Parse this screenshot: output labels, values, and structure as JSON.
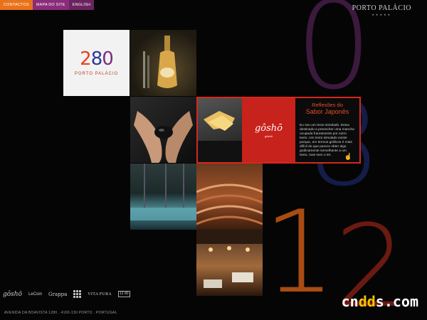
{
  "nav": {
    "contactos": "CONTACTOS",
    "mapa": "MAPA DO SITE",
    "english": "ENGLISH"
  },
  "brand": {
    "name": "PORTO PALÁCIO",
    "stars": "★★★★★"
  },
  "decor": {
    "top_digit": "0",
    "mid_digit": "8",
    "bottom_one": "1",
    "bottom_digit": "2"
  },
  "logo": {
    "num_1": "2",
    "num_8": "8",
    "num_0": "0",
    "sub": "PORTO PALÁCIO"
  },
  "feature": {
    "heading_top": "Reflexões do",
    "heading_bottom": "Sabor Japonês",
    "logo_text": "gôshō",
    "logo_sub": "gôshō",
    "body": "Eu sou um texto simulado. Estou destinado a preencher uma mancha ocupada futuramente por outro texto. Um texto simulado existe porque, em termos gráficos é mais difícil do que parece obter algo graficamente semelhante a um texto, mas sem o ter."
  },
  "partners": {
    "gosho": "gôshō",
    "lecoin": "LeCoin",
    "grappa": "Grappa",
    "vitapura": "VITA PURA",
    "last": "12 80"
  },
  "address": "AVENIDA DA BOAVISTA 1280 . 4100-130 PORTO . PORTUGAL",
  "watermark": {
    "a": "cn",
    "b": "dd",
    "c": "s.com"
  },
  "colors": {
    "orange": "#e9731b",
    "purple": "#8a2c7a",
    "red": "#d5281e",
    "blue": "#2a3a9a"
  }
}
